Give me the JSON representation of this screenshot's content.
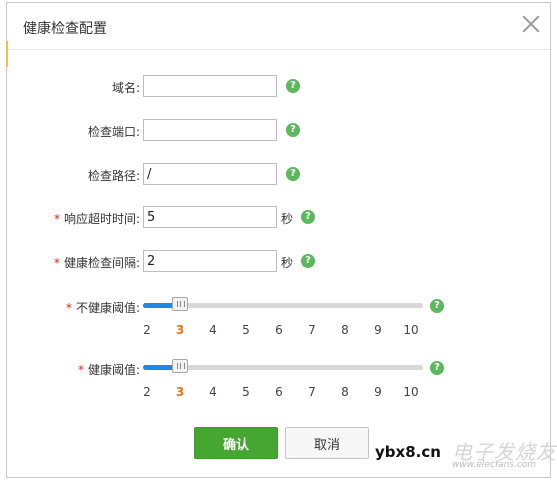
{
  "dialog": {
    "title": "健康检查配置",
    "close_icon": "close-icon"
  },
  "fields": {
    "domain": {
      "label": "域名:",
      "value": "",
      "required": false
    },
    "port": {
      "label": "检查端口:",
      "value": "",
      "required": false
    },
    "path": {
      "label": "检查路径:",
      "value": "/",
      "required": false
    },
    "timeout": {
      "label": "响应超时时间:",
      "value": "5",
      "unit": "秒",
      "required": true
    },
    "interval": {
      "label": "健康检查间隔:",
      "value": "2",
      "unit": "秒",
      "required": true
    }
  },
  "required_mark": "*",
  "help_glyph": "?",
  "sliders": {
    "unhealthy": {
      "label": "不健康阈值:",
      "min": 2,
      "max": 10,
      "value": 3,
      "ticks": [
        "2",
        "3",
        "4",
        "5",
        "6",
        "7",
        "8",
        "9",
        "10"
      ]
    },
    "healthy": {
      "label": "健康阈值:",
      "min": 2,
      "max": 10,
      "value": 3,
      "ticks": [
        "2",
        "3",
        "4",
        "5",
        "6",
        "7",
        "8",
        "9",
        "10"
      ]
    }
  },
  "buttons": {
    "confirm": "确认",
    "cancel": "取消"
  },
  "watermark": {
    "text": "ybx8.cn",
    "logo_text": "电子发烧友",
    "site": "www.elecfans.com"
  },
  "colors": {
    "accent_green": "#45a731",
    "help_green": "#5cb85c",
    "slider_blue": "#1e88e5",
    "active_tick": "#e8761c",
    "required_red": "#e02020"
  }
}
